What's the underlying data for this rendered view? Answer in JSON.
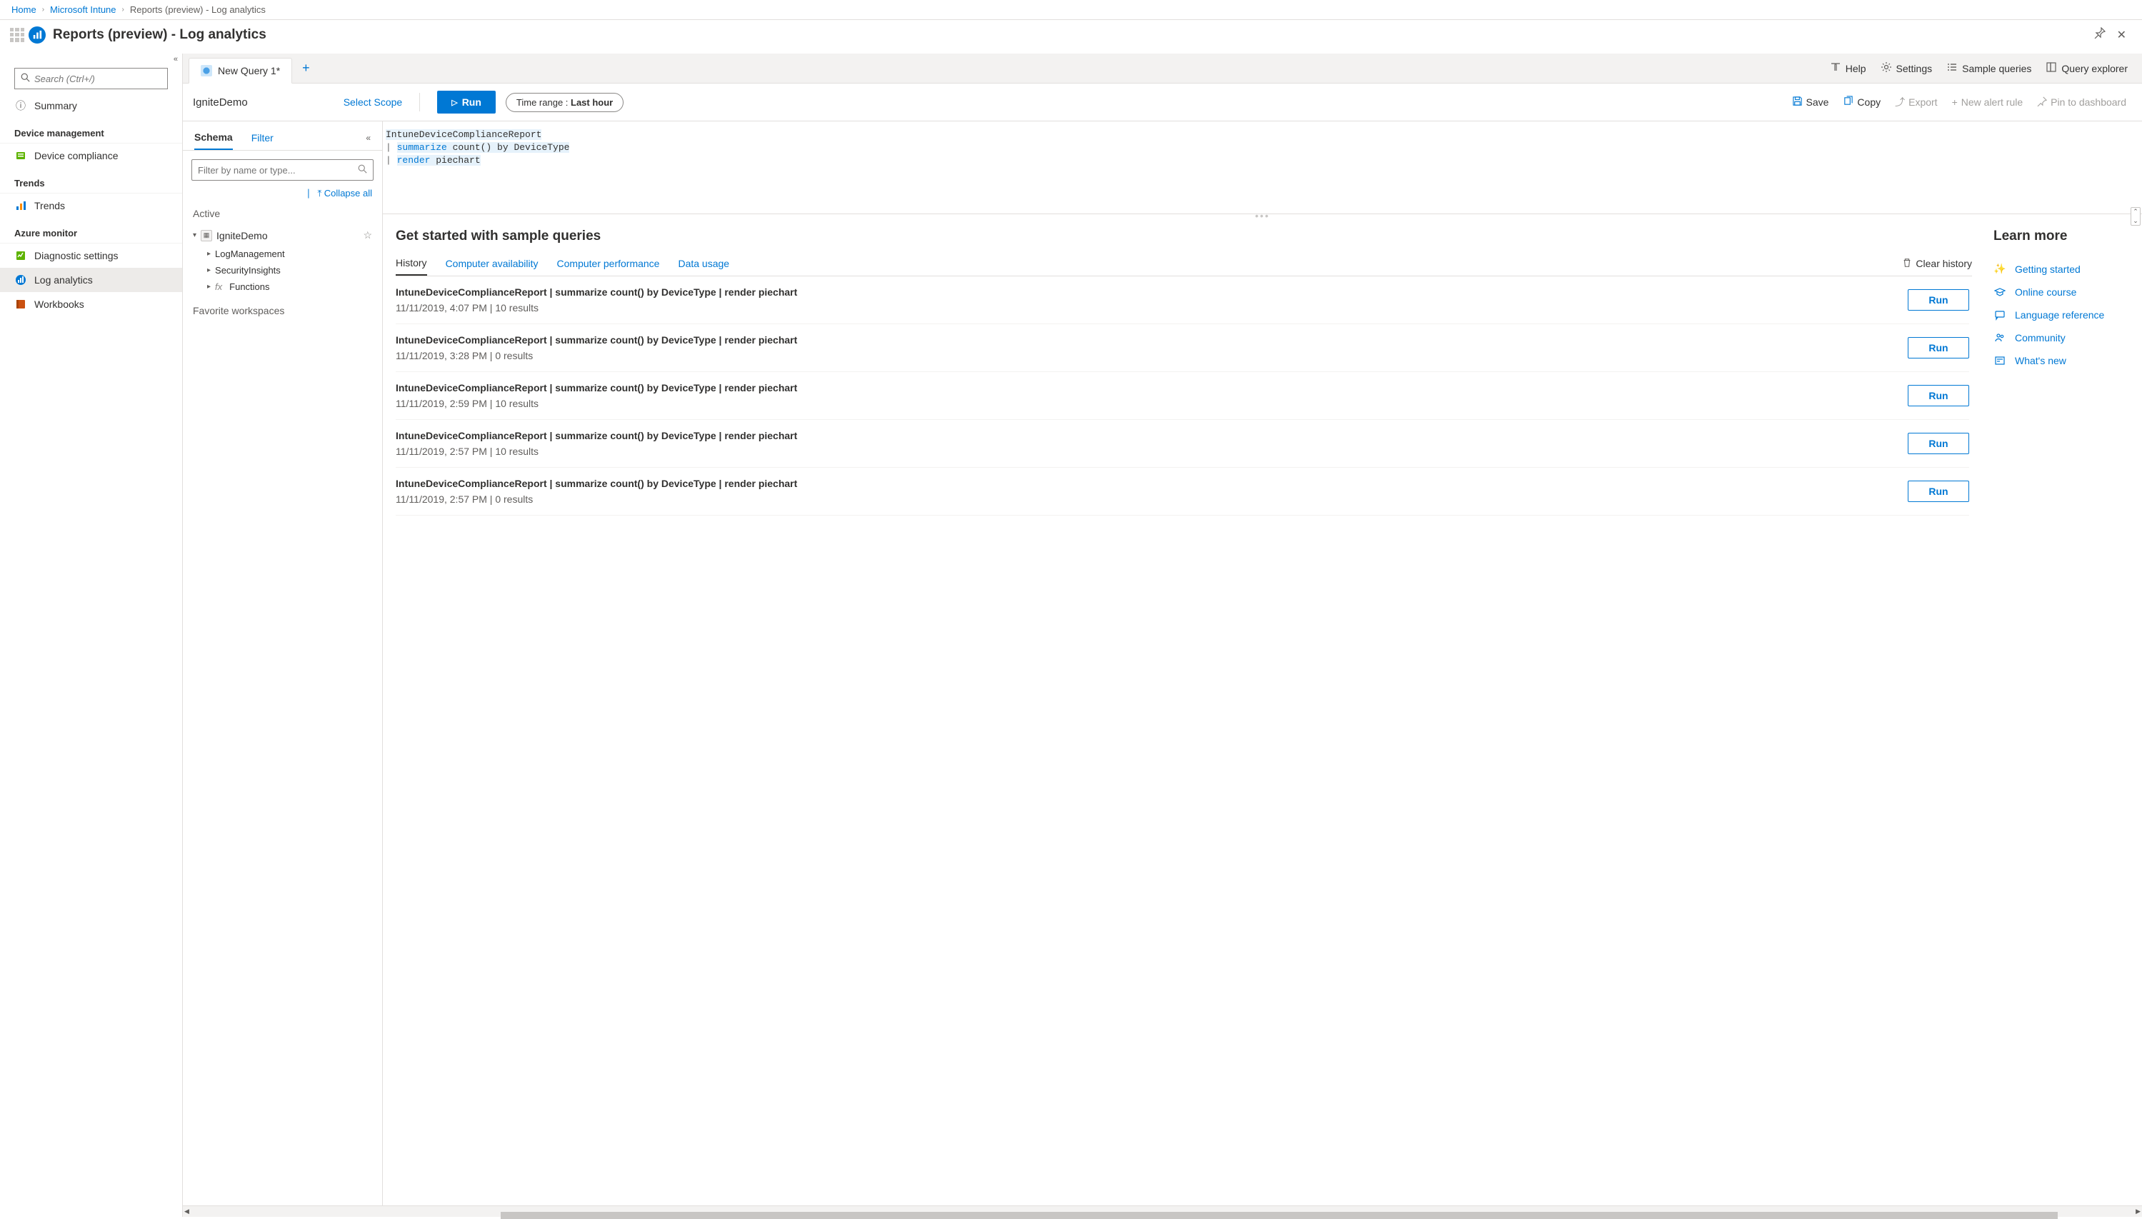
{
  "breadcrumbs": {
    "home": "Home",
    "intune": "Microsoft Intune",
    "current": "Reports (preview) - Log analytics"
  },
  "title": "Reports (preview) - Log analytics",
  "sidebar": {
    "searchPlaceholder": "Search (Ctrl+/)",
    "items": {
      "summary": "Summary"
    },
    "groups": {
      "deviceMgmt": "Device management",
      "trends": "Trends",
      "azureMon": "Azure monitor"
    },
    "deviceCompliance": "Device compliance",
    "trendsItem": "Trends",
    "diagSettings": "Diagnostic settings",
    "logAnalytics": "Log analytics",
    "workbooks": "Workbooks"
  },
  "queryTab": {
    "name": "New Query 1*"
  },
  "topActions": {
    "help": "Help",
    "settings": "Settings",
    "sampleQueries": "Sample queries",
    "queryExplorer": "Query explorer"
  },
  "toolbar": {
    "context": "IgniteDemo",
    "scope": "Select Scope",
    "run": "Run",
    "timeRangeLabel": "Time range : ",
    "timeRangeValue": "Last hour",
    "save": "Save",
    "copy": "Copy",
    "export": "Export",
    "newAlert": "New alert rule",
    "pin": "Pin to dashboard"
  },
  "schema": {
    "tabSchema": "Schema",
    "tabFilter": "Filter",
    "filterPlaceholder": "Filter by name or type...",
    "collapseAll": "Collapse all",
    "activeHeader": "Active",
    "workspace": "IgniteDemo",
    "children": [
      "LogManagement",
      "SecurityInsights",
      "Functions"
    ],
    "favHeader": "Favorite workspaces"
  },
  "editor": {
    "line1": "IntuneDeviceComplianceReport",
    "line2_prefix": "| ",
    "line2_kw": "summarize",
    "line2_rest": " count() by DeviceType",
    "line3_prefix": "| ",
    "line3_kw": "render",
    "line3_rest": " piechart"
  },
  "results": {
    "heading": "Get started with sample queries",
    "tabs": {
      "history": "History",
      "compAvail": "Computer availability",
      "compPerf": "Computer performance",
      "dataUsage": "Data usage"
    },
    "clear": "Clear history",
    "runBtn": "Run",
    "history": [
      {
        "q": "IntuneDeviceComplianceReport | summarize count() by DeviceType | render piechart",
        "meta": "11/11/2019, 4:07 PM | 10 results"
      },
      {
        "q": "IntuneDeviceComplianceReport | summarize count() by DeviceType | render piechart",
        "meta": "11/11/2019, 3:28 PM | 0 results"
      },
      {
        "q": "IntuneDeviceComplianceReport | summarize count() by DeviceType | render piechart",
        "meta": "11/11/2019, 2:59 PM | 10 results"
      },
      {
        "q": "IntuneDeviceComplianceReport | summarize count() by DeviceType | render piechart",
        "meta": "11/11/2019, 2:57 PM | 10 results"
      },
      {
        "q": "IntuneDeviceComplianceReport | summarize count() by DeviceType | render piechart",
        "meta": "11/11/2019, 2:57 PM | 0 results"
      }
    ]
  },
  "learn": {
    "heading": "Learn more",
    "items": {
      "getting": "Getting started",
      "course": "Online course",
      "lang": "Language reference",
      "community": "Community",
      "whatsnew": "What's new"
    }
  }
}
